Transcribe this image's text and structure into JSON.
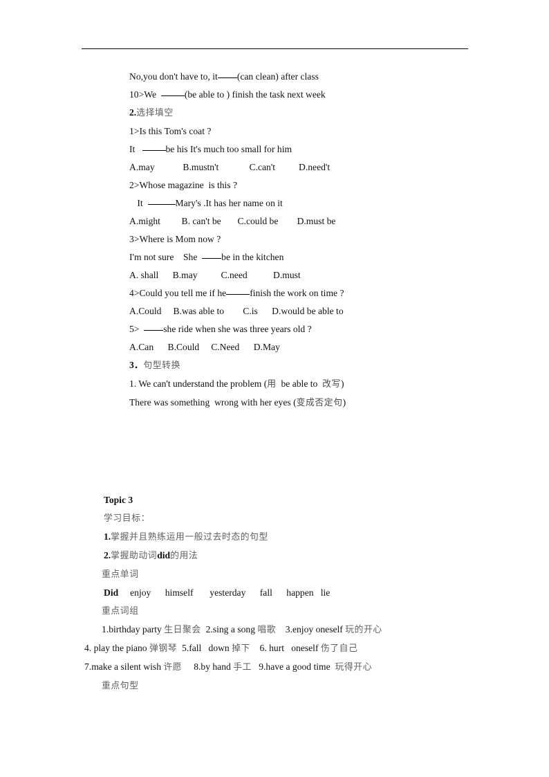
{
  "document": {
    "sections": {
      "exercises": {
        "lines": [
          {
            "id": "l1",
            "pre": "No,you don't have to, it",
            "blank": "w1",
            "post": "(can clean) after class"
          },
          {
            "id": "l2",
            "pre": "10>We  ",
            "blank": "w2",
            "post": "(be able to ) finish the task next week"
          },
          {
            "id": "l3",
            "num": "2.",
            "cn": "选择填空"
          },
          {
            "id": "l4",
            "text": "1>Is this Tom's coat ?"
          },
          {
            "id": "l5",
            "pre": "It   ",
            "blank": "w2",
            "post": "be his It's much too small for him"
          },
          {
            "id": "l6",
            "text": "A.may            B.mustn't             C.can't          D.need't"
          },
          {
            "id": "l7",
            "text": "2>Whose magazine  is this ?"
          },
          {
            "id": "l8",
            "pre": " It  ",
            "blank": "w3",
            "post": "Mary's .It has her name on it",
            "indent": "sub"
          },
          {
            "id": "l9",
            "text": "A.might         B. can't be       C.could be        D.must be"
          },
          {
            "id": "l10",
            "text": "3>Where is Mom now ?"
          },
          {
            "id": "l11",
            "pre": "I'm not sure    She  ",
            "blank": "w1",
            "post": "be in the kitchen"
          },
          {
            "id": "l12",
            "text": "A. shall      B.may          C.need           D.must"
          },
          {
            "id": "l13",
            "pre": "4>Could you tell me if he",
            "blank": "w2",
            "post": "finish the work on time ?"
          },
          {
            "id": "l14",
            "text": "A.Could     B.was able to        C.is      D.would be able to"
          },
          {
            "id": "l15",
            "pre": "5>  ",
            "blank": "w1",
            "post": "she ride when she was three years old ?"
          },
          {
            "id": "l16",
            "text": "A.Can      B.Could     C.Need      D.May"
          },
          {
            "id": "l17",
            "num": "3．",
            "cn": "句型转换"
          },
          {
            "id": "l18",
            "pre": "1. We can't understand the problem (",
            "cn_inline": "用",
            "mid": "  be able to  ",
            "cn_inline2": "改写",
            "post": ")"
          },
          {
            "id": "l19",
            "pre": "There was something  wrong with her eyes (",
            "cn_inline": "变成否定句",
            "post": ")"
          }
        ]
      },
      "topic3": {
        "title": "Topic 3",
        "lines": [
          {
            "id": "t1",
            "cn": "学习目标："
          },
          {
            "id": "t2",
            "num": "1.",
            "cn": "掌握并且熟练运用一般过去时态的句型"
          },
          {
            "id": "t3",
            "num": "2.",
            "cn_pre": "掌握助动词",
            "en": "did",
            "cn_post": "的用法"
          },
          {
            "id": "t4",
            "cn": "重点单词",
            "indent": "phr"
          },
          {
            "id": "t5",
            "bold_first": "Did",
            "text": "     enjoy      himself       yesterday      fall      happen   lie"
          },
          {
            "id": "t6",
            "cn": "重点词组",
            "indent": "phr"
          },
          {
            "id": "t7",
            "indent": "phr-list",
            "parts": [
              {
                "en": "1.birthday party ",
                "cn": "生日聚会"
              },
              {
                "en": "  2.sing a song ",
                "cn": "唱歌"
              },
              {
                "en": "    3.enjoy oneself ",
                "cn": "玩的开心"
              }
            ]
          },
          {
            "id": "t8",
            "indent": "flush",
            "parts": [
              {
                "en": "4. play the piano ",
                "cn": "弹钢琴"
              },
              {
                "en": "  5.fall   down ",
                "cn": "掉下"
              },
              {
                "en": "    6. hurt   oneself ",
                "cn": "伤了自己"
              }
            ]
          },
          {
            "id": "t9",
            "indent": "flush",
            "parts": [
              {
                "en": "7.make a silent wish ",
                "cn": "许愿"
              },
              {
                "en": "     8.by hand ",
                "cn": "手工"
              },
              {
                "en": "   9.have a good time  ",
                "cn": "玩得开心"
              }
            ]
          },
          {
            "id": "t10",
            "cn": "重点句型",
            "indent": "phr"
          }
        ]
      }
    }
  }
}
